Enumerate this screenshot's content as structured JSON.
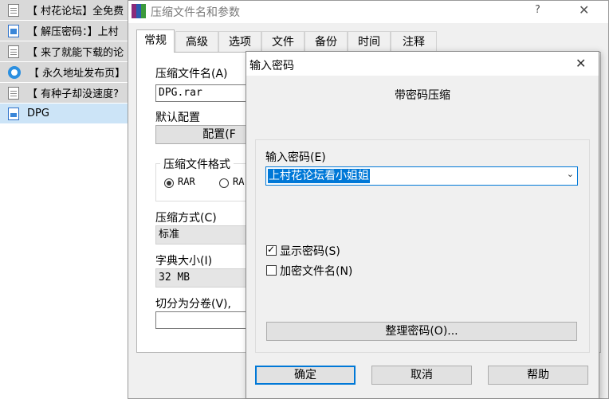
{
  "file_list": [
    {
      "name": "【 村花论坛】全免费",
      "icon": "text-file-icon"
    },
    {
      "name": "【 解压密码：】上村",
      "icon": "image-file-icon"
    },
    {
      "name": "【 来了就能下载的论",
      "icon": "text-file-icon"
    },
    {
      "name": "【 永久地址发布页】",
      "icon": "web-link-icon"
    },
    {
      "name": "【 有种子却没速度?",
      "icon": "text-file-icon"
    },
    {
      "name": "DPG",
      "icon": "document-file-icon"
    }
  ],
  "archive_dialog": {
    "title": "压缩文件名和参数",
    "help": "?",
    "close": "✕",
    "tabs": [
      "常规",
      "高级",
      "选项",
      "文件",
      "备份",
      "时间",
      "注释"
    ],
    "archive_name_label": "压缩文件名(A)",
    "archive_name_value": "DPG.rar",
    "default_profile_label": "默认配置",
    "profiles_button": "配置(F",
    "format_label": "压缩文件格式",
    "format_options": [
      "RAR",
      "RA"
    ],
    "method_label": "压缩方式(C)",
    "method_value": "标准",
    "dict_label": "字典大小(I)",
    "dict_value": "32 MB",
    "split_label": "切分为分卷(V),"
  },
  "password_dialog": {
    "title": "输入密码",
    "close": "✕",
    "heading": "带密码压缩",
    "input_label": "输入密码(E)",
    "password_value": "上村花论坛看小姐姐",
    "show_password_label": "显示密码(S)",
    "show_password_checked": true,
    "encrypt_names_label": "加密文件名(N)",
    "encrypt_names_checked": false,
    "organize_button": "整理密码(O)...",
    "ok_button": "确定",
    "cancel_button": "取消",
    "help_button": "帮助"
  },
  "colors": {
    "selection": "#0078d7",
    "file_row": "#d9d9d9",
    "dialog_bg": "#f0f0f0"
  }
}
